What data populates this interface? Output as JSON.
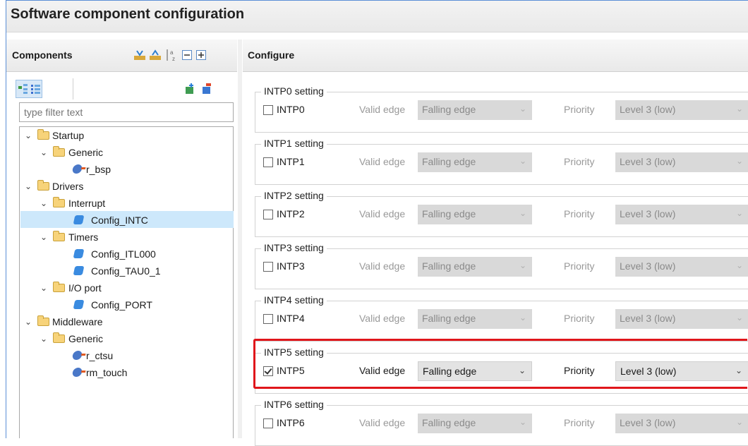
{
  "window": {
    "title": "Software component configuration"
  },
  "components_panel": {
    "title": "Components",
    "filter_placeholder": "type filter text",
    "tree": [
      {
        "label": "Startup"
      },
      {
        "label": "Generic"
      },
      {
        "label": "r_bsp"
      },
      {
        "label": "Drivers"
      },
      {
        "label": "Interrupt"
      },
      {
        "label": "Config_INTC",
        "selected": true
      },
      {
        "label": "Timers"
      },
      {
        "label": "Config_ITL000"
      },
      {
        "label": "Config_TAU0_1"
      },
      {
        "label": "I/O port"
      },
      {
        "label": "Config_PORT"
      },
      {
        "label": "Middleware"
      },
      {
        "label": "Generic"
      },
      {
        "label": "r_ctsu"
      },
      {
        "label": "rm_touch"
      }
    ]
  },
  "configure_panel": {
    "title": "Configure",
    "settings": [
      {
        "group": "INTP0 setting",
        "checkbox": "INTP0",
        "checked": false,
        "edge_label": "Valid edge",
        "edge": "Falling edge",
        "priority_label": "Priority",
        "priority": "Level 3 (low)"
      },
      {
        "group": "INTP1 setting",
        "checkbox": "INTP1",
        "checked": false,
        "edge_label": "Valid edge",
        "edge": "Falling edge",
        "priority_label": "Priority",
        "priority": "Level 3 (low)"
      },
      {
        "group": "INTP2 setting",
        "checkbox": "INTP2",
        "checked": false,
        "edge_label": "Valid edge",
        "edge": "Falling edge",
        "priority_label": "Priority",
        "priority": "Level 3 (low)"
      },
      {
        "group": "INTP3 setting",
        "checkbox": "INTP3",
        "checked": false,
        "edge_label": "Valid edge",
        "edge": "Falling edge",
        "priority_label": "Priority",
        "priority": "Level 3 (low)"
      },
      {
        "group": "INTP4 setting",
        "checkbox": "INTP4",
        "checked": false,
        "edge_label": "Valid edge",
        "edge": "Falling edge",
        "priority_label": "Priority",
        "priority": "Level 3 (low)"
      },
      {
        "group": "INTP5 setting",
        "checkbox": "INTP5",
        "checked": true,
        "edge_label": "Valid edge",
        "edge": "Falling edge",
        "priority_label": "Priority",
        "priority": "Level 3 (low)"
      },
      {
        "group": "INTP6 setting",
        "checkbox": "INTP6",
        "checked": false,
        "edge_label": "Valid edge",
        "edge": "Falling edge",
        "priority_label": "Priority",
        "priority": "Level 3 (low)"
      }
    ]
  },
  "colors": {
    "highlight": "#e0161b",
    "selection": "#cde8fb",
    "folder": "#f7d37a",
    "window_border": "#5b8fd6"
  }
}
